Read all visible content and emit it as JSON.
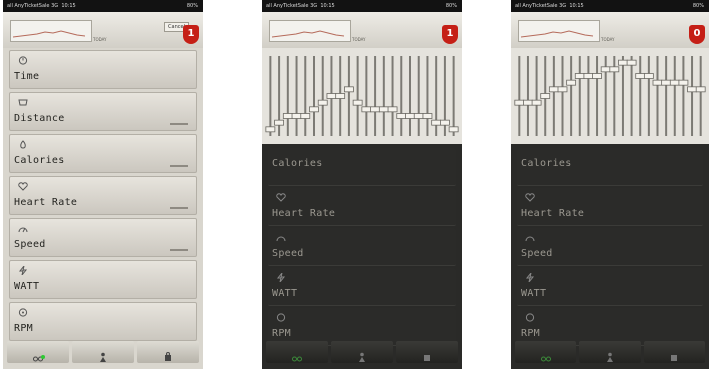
{
  "statusbar": {
    "carrier": "all AnyTicketSale 3G",
    "time": "10:15",
    "battery": "80%"
  },
  "header": {
    "mini_caption": "TODAY",
    "cancel_label": "Cancel",
    "badge": "1",
    "badge_alt": "0"
  },
  "screen1": {
    "menu": [
      {
        "label": "Time",
        "icon": "clock-icon"
      },
      {
        "label": "Distance",
        "icon": "route-icon"
      },
      {
        "label": "Calories",
        "icon": "flame-icon"
      },
      {
        "label": "Heart Rate",
        "icon": "heart-icon"
      },
      {
        "label": "Speed",
        "icon": "speed-icon"
      },
      {
        "label": "WATT",
        "icon": "bolt-icon"
      },
      {
        "label": "RPM",
        "icon": "gauge-icon"
      }
    ]
  },
  "screen2": {
    "menu": [
      {
        "label": "Calories",
        "icon": "flame-icon"
      },
      {
        "label": "Heart Rate",
        "icon": "heart-icon"
      },
      {
        "label": "Speed",
        "icon": "speed-icon"
      },
      {
        "label": "WATT",
        "icon": "bolt-icon"
      },
      {
        "label": "RPM",
        "icon": "gauge-icon"
      }
    ],
    "graph_levels": [
      1,
      2,
      3,
      3,
      3,
      4,
      5,
      6,
      6,
      7,
      5,
      4,
      4,
      4,
      4,
      3,
      3,
      3,
      3,
      2,
      2,
      1
    ]
  },
  "screen3": {
    "menu": [
      {
        "label": "Calories",
        "icon": "flame-icon"
      },
      {
        "label": "Heart Rate",
        "icon": "heart-icon"
      },
      {
        "label": "Speed",
        "icon": "speed-icon"
      },
      {
        "label": "WATT",
        "icon": "bolt-icon"
      },
      {
        "label": "RPM",
        "icon": "gauge-icon"
      }
    ],
    "graph_levels": [
      5,
      5,
      5,
      6,
      7,
      7,
      8,
      9,
      9,
      9,
      10,
      10,
      11,
      11,
      9,
      9,
      8,
      8,
      8,
      8,
      7,
      7
    ]
  },
  "tabbar": {
    "icons": [
      "bike-icon",
      "person-icon",
      "weight-icon"
    ],
    "active_indicator_color": "#2ec833"
  },
  "colors": {
    "accent_red": "#c51f16",
    "light_bg": "#d9d6ce",
    "dark_bg": "#2a2a28"
  }
}
